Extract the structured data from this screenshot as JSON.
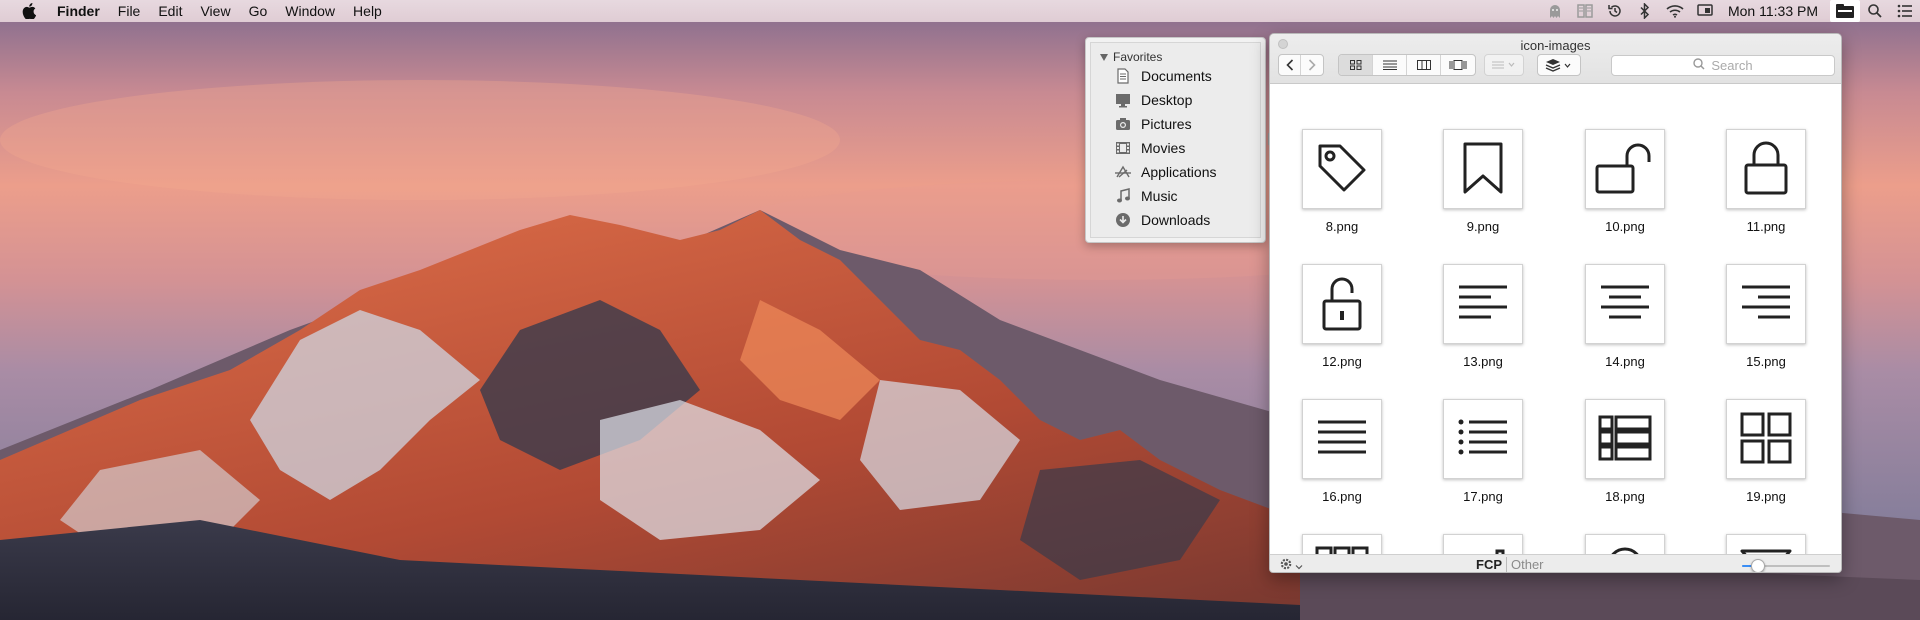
{
  "menubar": {
    "app_name": "Finder",
    "menus": [
      "File",
      "Edit",
      "View",
      "Go",
      "Window",
      "Help"
    ],
    "clock": "Mon 11:33 PM"
  },
  "sidebar": {
    "section": "Favorites",
    "items": [
      {
        "label": "Documents",
        "icon": "document-icon"
      },
      {
        "label": "Desktop",
        "icon": "desktop-icon"
      },
      {
        "label": "Pictures",
        "icon": "camera-icon"
      },
      {
        "label": "Movies",
        "icon": "film-icon"
      },
      {
        "label": "Applications",
        "icon": "applications-icon"
      },
      {
        "label": "Music",
        "icon": "music-note-icon"
      },
      {
        "label": "Downloads",
        "icon": "download-icon"
      }
    ]
  },
  "window": {
    "title": "icon-images",
    "search_placeholder": "Search",
    "files": [
      {
        "name": "8.png",
        "icon": "tag-icon"
      },
      {
        "name": "9.png",
        "icon": "bookmark-icon"
      },
      {
        "name": "10.png",
        "icon": "unlock-wide-icon"
      },
      {
        "name": "11.png",
        "icon": "lock-icon"
      },
      {
        "name": "12.png",
        "icon": "unlock-icon"
      },
      {
        "name": "13.png",
        "icon": "align-left-icon"
      },
      {
        "name": "14.png",
        "icon": "align-center-icon"
      },
      {
        "name": "15.png",
        "icon": "align-right-icon"
      },
      {
        "name": "16.png",
        "icon": "justify-icon"
      },
      {
        "name": "17.png",
        "icon": "list-icon"
      },
      {
        "name": "18.png",
        "icon": "list-view-icon"
      },
      {
        "name": "19.png",
        "icon": "grid-2x2-icon"
      },
      {
        "name": "",
        "icon": "grid-3x3-icon"
      },
      {
        "name": "",
        "icon": "bar-chart-icon"
      },
      {
        "name": "",
        "icon": "map-pin-icon"
      },
      {
        "name": "",
        "icon": "filter-icon"
      }
    ],
    "status": {
      "tag_selected": "FCP",
      "tag_other": "Other",
      "zoom_fraction": 0.18
    }
  }
}
